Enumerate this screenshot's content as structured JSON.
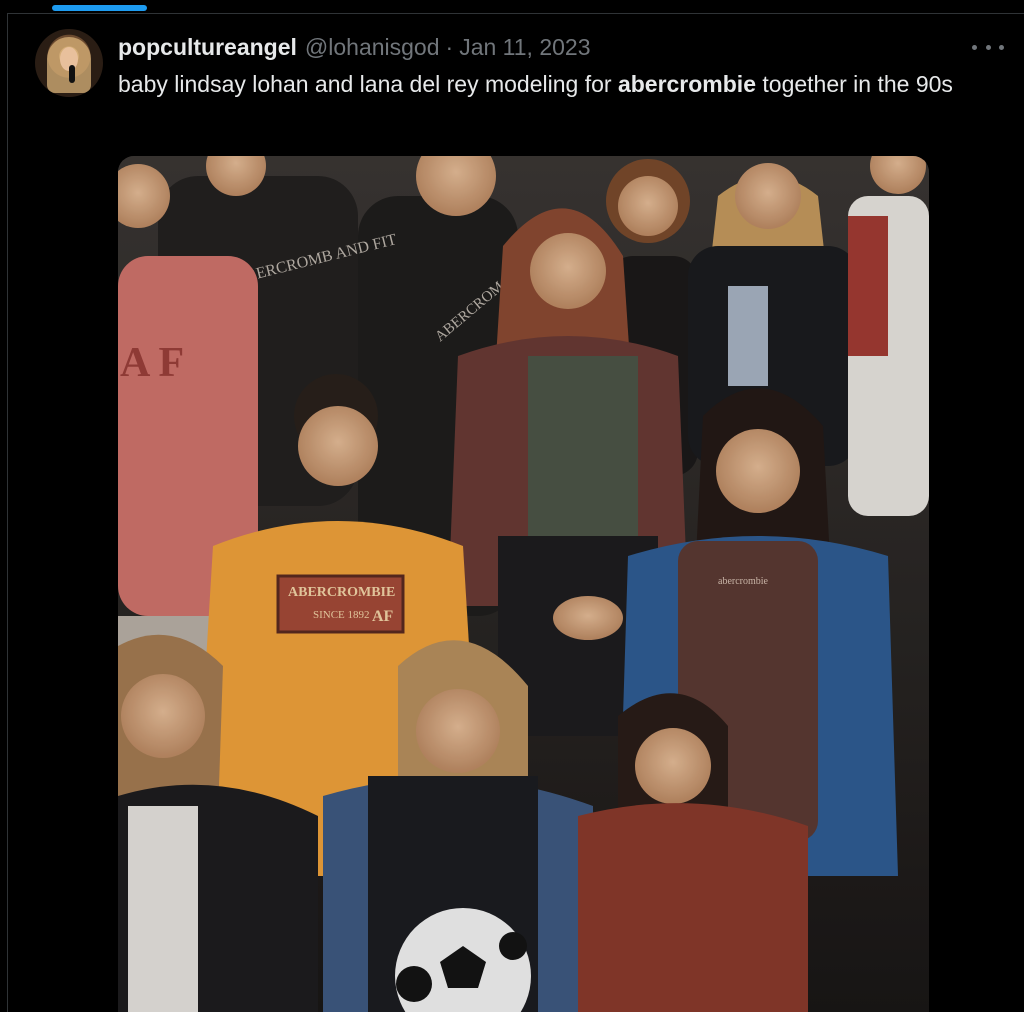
{
  "tweet": {
    "display_name": "popcultureangel",
    "handle": "@lohanisgod",
    "separator": "·",
    "date": "Jan 11, 2023",
    "text_before": "baby lindsay lohan and lana del rey modeling for ",
    "text_bold": "abercrombie",
    "text_after": " together in the 90s",
    "media_prints": {
      "shirt_1": "ABERCROMB AND FIT",
      "shirt_2": "ABERCROM",
      "shirt_3_line1": "ABERCROMBIE",
      "shirt_3_line2": "SINCE 1892",
      "shirt_3_badge": "AF",
      "shirt_4": "abercrombie",
      "shirt_5": "A  F"
    }
  },
  "icons": {
    "more": "more-horizontal-icon",
    "avatar": "profile-avatar"
  },
  "colors": {
    "background": "#000000",
    "text_primary": "#e7e9ea",
    "text_secondary": "#71767b",
    "accent": "#1d9bf0",
    "border": "#2f3336"
  }
}
